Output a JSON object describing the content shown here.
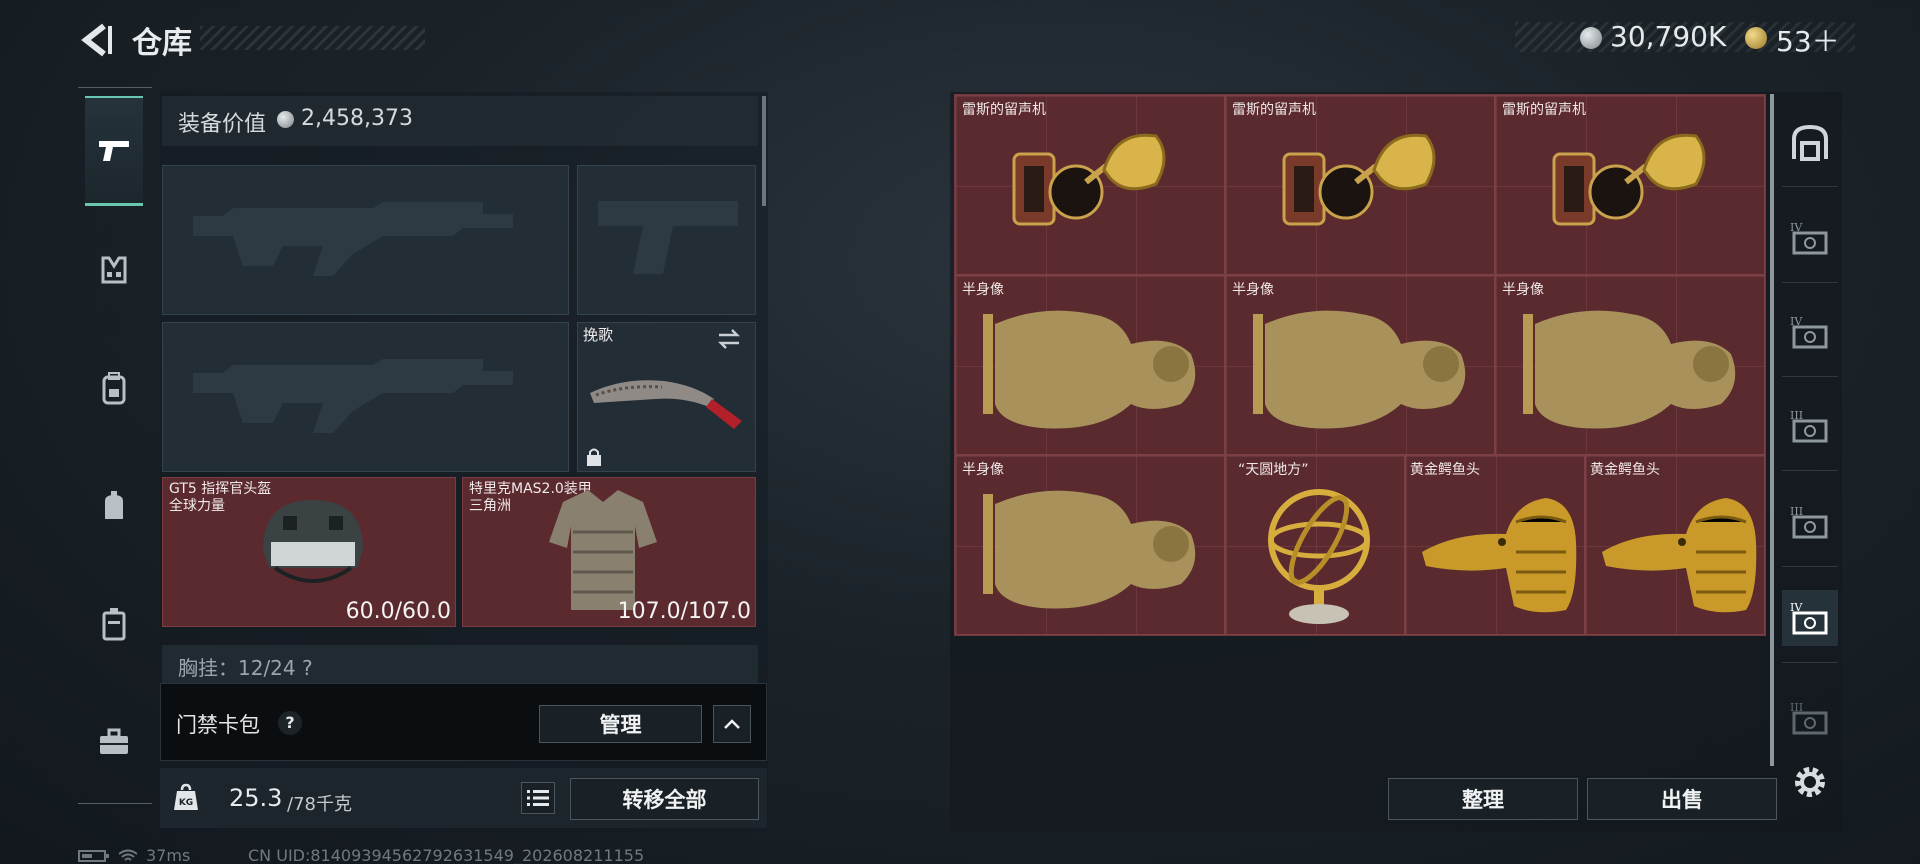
{
  "header": {
    "title": "仓库",
    "currency_silver": "30,790K",
    "currency_gold": "53＋"
  },
  "left_panel": {
    "equipment_value_label": "装备价值",
    "equipment_value": "2,458,373",
    "melee": {
      "name": "挽歌"
    },
    "helmet": {
      "name": "GT5 指挥官头盔",
      "faction": "全球力量",
      "durability": "60.0/60.0"
    },
    "armor": {
      "name": "特里克MAS2.0装甲",
      "faction": "三角洲",
      "durability": "107.0/107.0"
    },
    "chest_rig": {
      "text": "胸挂：12/24  ?"
    },
    "keycard": {
      "label": "门禁卡包",
      "help": "?",
      "manage_label": "管理"
    },
    "weight": {
      "current": "25.3",
      "capacity": "/78千克",
      "kg_label": "KG"
    },
    "transfer_all_label": "转移全部"
  },
  "status": {
    "ping": "37ms",
    "uid": "CN UID:8140939456279263154​9_202608211155"
  },
  "stash": {
    "items": [
      {
        "label": "雷斯的留声机",
        "type": "gramophone"
      },
      {
        "label": "雷斯的留声机",
        "type": "gramophone"
      },
      {
        "label": "雷斯的留声机",
        "type": "gramophone"
      },
      {
        "label": "半身像",
        "type": "bust"
      },
      {
        "label": "半身像",
        "type": "bust"
      },
      {
        "label": "半身像",
        "type": "bust"
      },
      {
        "label": "半身像",
        "type": "bust"
      },
      {
        "label": "“天圆地方”",
        "type": "armillary"
      },
      {
        "label": "黄金鳄鱼头",
        "type": "croc"
      },
      {
        "label": "黄金鳄鱼头",
        "type": "croc"
      }
    ],
    "sort_label": "整理",
    "sell_label": "出售",
    "tabs": [
      {
        "icon": "backpack-icon",
        "level": ""
      },
      {
        "icon": "case-icon",
        "level": "IV"
      },
      {
        "icon": "case-icon",
        "level": "IV"
      },
      {
        "icon": "case-icon",
        "level": "III"
      },
      {
        "icon": "case-icon",
        "level": "III"
      },
      {
        "icon": "case-icon",
        "level": "IV"
      },
      {
        "icon": "case-icon",
        "level": "III"
      }
    ]
  },
  "colors": {
    "accent": "#69c7b1",
    "item_bg": "#5a2a2e",
    "panel_bg": "#222d35"
  }
}
